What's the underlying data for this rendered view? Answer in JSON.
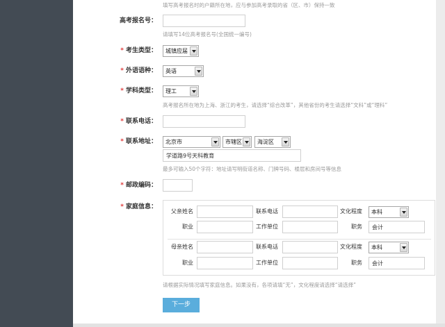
{
  "theme": {
    "sidebar": "#434b54",
    "accent": "#5aaddc",
    "required": "#e03a3a"
  },
  "icons": {
    "select_arrow": "dropdown-arrow-icon"
  },
  "form": {
    "top_hint": "填写高考报名时的户籍所在地，应与参加高考录取的省（区、市）保持一致",
    "exam_number": {
      "label": "高考报名号：",
      "hint": "请填写14位高考报名号(全国统一编号)"
    },
    "student_type": {
      "required": "*",
      "label": "考生类型：",
      "value": "城镇应届"
    },
    "language": {
      "required": "*",
      "label": "外语语种：",
      "value": "英语"
    },
    "subject_type": {
      "required": "*",
      "label": "学科类型：",
      "value": "理工",
      "hint": "高考报名所在地为上海、浙江的考生，请选择“综合改革”，其他省份的考生请选择“文科”或“理科”"
    },
    "phone": {
      "required": "*",
      "label": "联系电话："
    },
    "address": {
      "required": "*",
      "label": "联系地址：",
      "province": "北京市",
      "city": "市辖区",
      "district": "海淀区",
      "detail": "学道路9号天科教育",
      "hint": "最多可输入50个字符：地址请写明街道名称、门牌号码、楼层和房间号等信息"
    },
    "postcode": {
      "required": "*",
      "label": "邮政编码："
    },
    "family": {
      "required": "*",
      "label": "家庭信息：",
      "father": {
        "name_label": "父亲姓名",
        "phone_label": "联系电话",
        "education_label": "文化程度",
        "education": "本科",
        "occupation_label": "职业",
        "workplace_label": "工作单位",
        "position_label": "职务",
        "position": "会计"
      },
      "mother": {
        "name_label": "母亲姓名",
        "phone_label": "联系电话",
        "education_label": "文化程度",
        "education": "本科",
        "occupation_label": "职业",
        "workplace_label": "工作单位",
        "position_label": "职务",
        "position": "会计"
      },
      "hint": "请根据实际情况填写家庭信息。如果没有，各项请填“无”，文化程度请选择“请选择”"
    },
    "next_button": "下一步"
  }
}
